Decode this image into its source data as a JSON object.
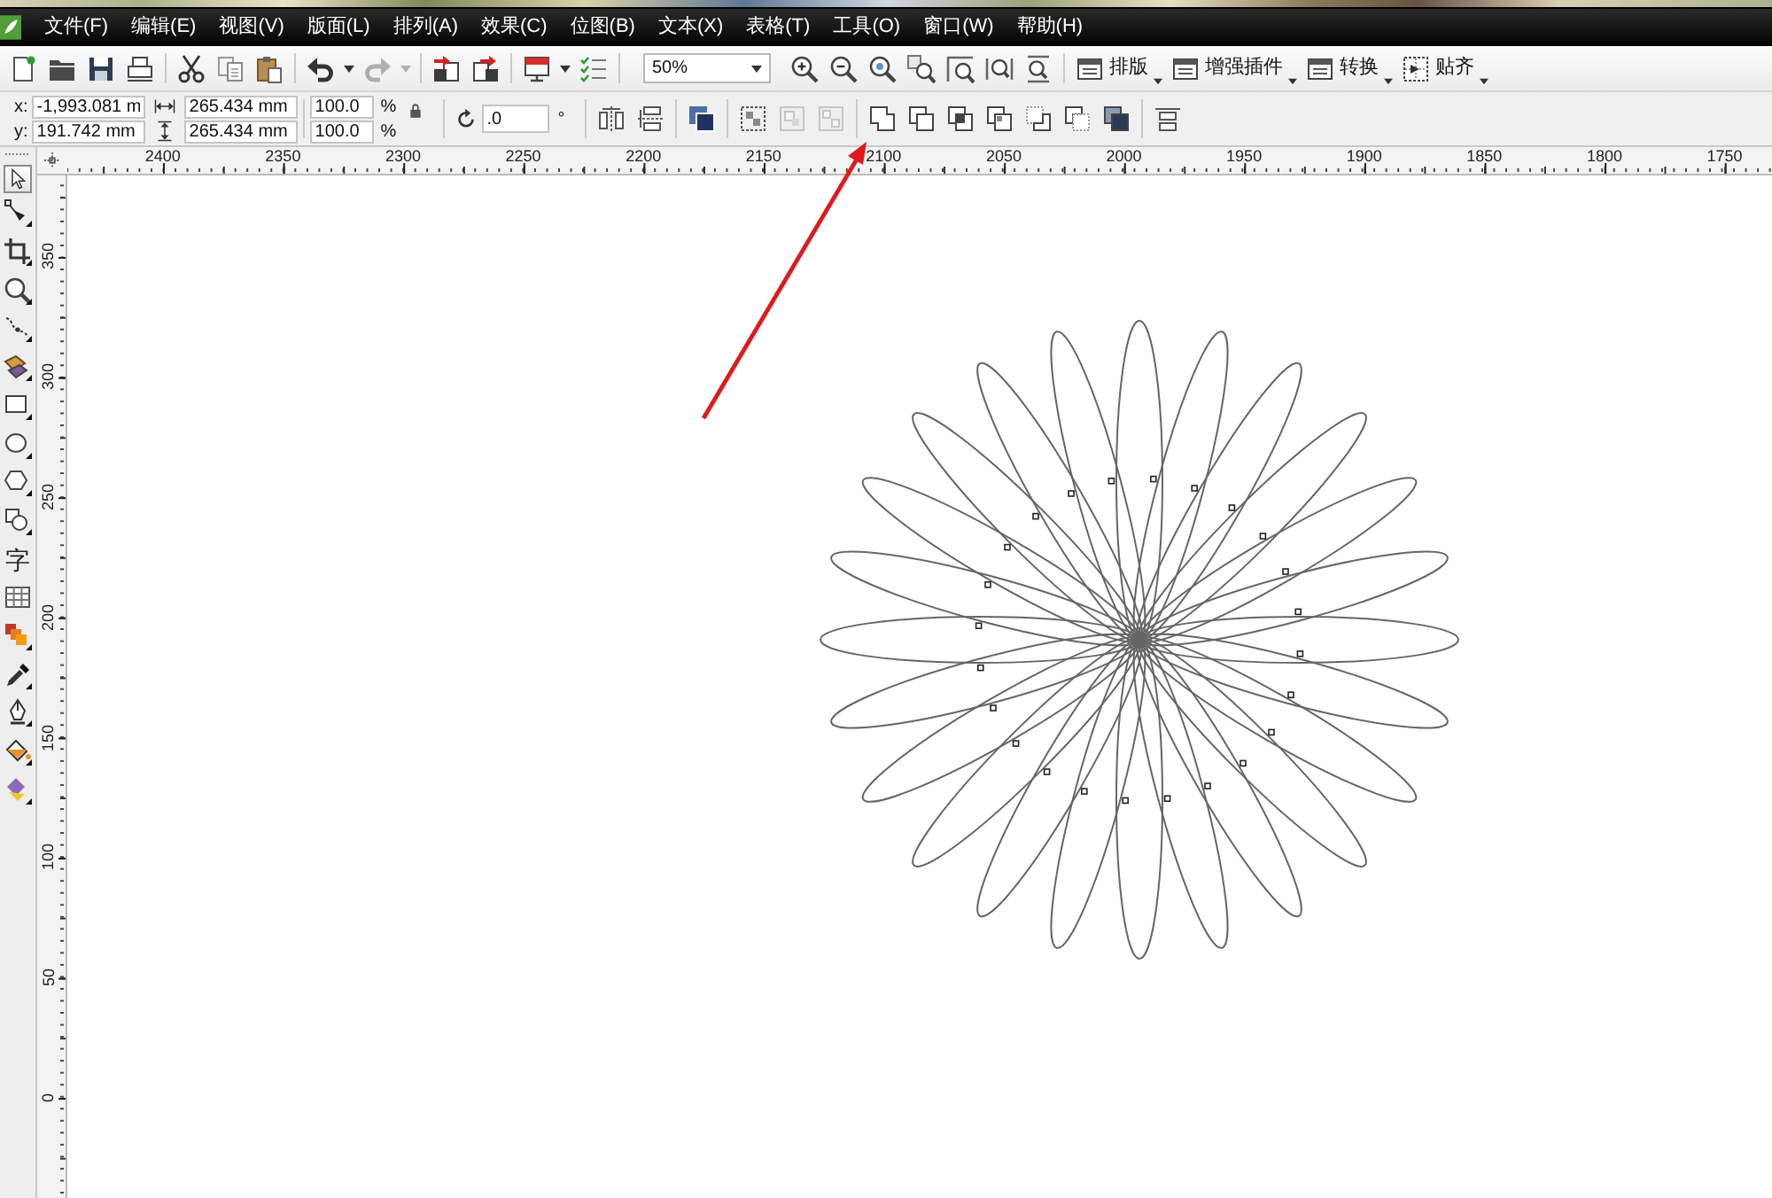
{
  "menu_bar": {
    "items": [
      "文件(F)",
      "编辑(E)",
      "视图(V)",
      "版面(L)",
      "排列(A)",
      "效果(C)",
      "位图(B)",
      "文本(X)",
      "表格(T)",
      "工具(O)",
      "窗口(W)",
      "帮助(H)"
    ]
  },
  "standard_toolbar": {
    "groups": [
      {
        "items": [
          {
            "kind": "new",
            "disabled": false
          },
          {
            "kind": "open",
            "disabled": false
          },
          {
            "kind": "save",
            "disabled": false
          },
          {
            "kind": "print",
            "disabled": false
          }
        ]
      },
      {
        "items": [
          {
            "kind": "cut",
            "disabled": false
          },
          {
            "kind": "copy",
            "disabled": false
          },
          {
            "kind": "paste",
            "disabled": false
          }
        ]
      },
      {
        "items": [
          {
            "kind": "undo",
            "disabled": false
          },
          {
            "kind": "caret",
            "disabled": false
          },
          {
            "kind": "redo",
            "disabled": true
          },
          {
            "kind": "caret",
            "disabled": true
          }
        ]
      },
      {
        "items": [
          {
            "kind": "import",
            "disabled": false
          },
          {
            "kind": "export",
            "disabled": false
          }
        ]
      },
      {
        "items": [
          {
            "kind": "launcher",
            "disabled": false
          },
          {
            "kind": "caret",
            "disabled": false
          },
          {
            "kind": "options",
            "disabled": false
          }
        ]
      }
    ],
    "zoom_level": {
      "value": "50%"
    },
    "zoom_tools": [
      {
        "kind": "zoom-in",
        "disabled": false
      },
      {
        "kind": "zoom-out",
        "disabled": false
      },
      {
        "kind": "zoom-selection",
        "disabled": false
      },
      {
        "kind": "zoom-objects",
        "disabled": false
      },
      {
        "kind": "zoom-page",
        "disabled": false
      },
      {
        "kind": "zoom-width",
        "disabled": false
      },
      {
        "kind": "zoom-height",
        "disabled": false
      }
    ],
    "menu_buttons": [
      {
        "kind": "panel",
        "label": "排版"
      },
      {
        "kind": "panel",
        "label": "增强插件"
      },
      {
        "kind": "panel",
        "label": "转换"
      },
      {
        "kind": "snap",
        "label": "贴齐"
      }
    ]
  },
  "property_bar": {
    "position": [
      {
        "label": "x:",
        "value": "-1,993.081 m"
      },
      {
        "label": "y:",
        "value": "191.742 mm"
      }
    ],
    "size": [
      {
        "kind": "width",
        "value": "265.434 mm"
      },
      {
        "kind": "height",
        "value": "265.434 mm"
      }
    ],
    "scale": [
      {
        "value": "100.0",
        "unit": "%"
      },
      {
        "value": "100.0",
        "unit": "%"
      }
    ],
    "rotation": {
      "value": ".0",
      "unit": "°"
    },
    "tool_groups": [
      {
        "items": [
          {
            "kind": "mirror-h",
            "disabled": false
          },
          {
            "kind": "mirror-v",
            "disabled": false
          }
        ]
      },
      {
        "items": [
          {
            "kind": "order",
            "disabled": false
          }
        ]
      },
      {
        "items": [
          {
            "kind": "group",
            "disabled": false
          },
          {
            "kind": "ungroup",
            "disabled": true
          },
          {
            "kind": "ungroup-all",
            "disabled": true
          }
        ]
      },
      {
        "items": [
          {
            "kind": "weld",
            "disabled": false
          },
          {
            "kind": "trim",
            "disabled": false
          },
          {
            "kind": "intersect",
            "disabled": false
          },
          {
            "kind": "simplify",
            "disabled": false
          },
          {
            "kind": "front-minus-back",
            "disabled": false
          },
          {
            "kind": "back-minus-front",
            "disabled": false
          },
          {
            "kind": "boundary",
            "disabled": false
          }
        ]
      },
      {
        "items": [
          {
            "kind": "align",
            "disabled": false
          }
        ]
      }
    ]
  },
  "toolbox": {
    "tools": [
      {
        "kind": "pick",
        "selected": true
      },
      {
        "kind": "shape",
        "selected": false
      },
      {
        "kind": "crop",
        "selected": false
      },
      {
        "kind": "zoom",
        "selected": false
      },
      {
        "kind": "curve",
        "selected": false
      },
      {
        "kind": "smart-fill",
        "selected": false
      },
      {
        "kind": "rectangle",
        "selected": false
      },
      {
        "kind": "ellipse",
        "selected": false
      },
      {
        "kind": "polygon",
        "selected": false
      },
      {
        "kind": "basic-shapes",
        "selected": false
      },
      {
        "kind": "text",
        "label": "字",
        "selected": false
      },
      {
        "kind": "table",
        "selected": false
      },
      {
        "kind": "blend",
        "selected": false
      },
      {
        "kind": "eyedropper",
        "selected": false
      },
      {
        "kind": "outline",
        "selected": false
      },
      {
        "kind": "fill",
        "selected": false
      },
      {
        "kind": "interactive-fill",
        "selected": false
      }
    ]
  },
  "rulers": {
    "horizontal": [
      "2400",
      "2350",
      "2300",
      "2250",
      "2200",
      "2150",
      "2100",
      "2050",
      "2000",
      "1950",
      "1900",
      "1850",
      "1800",
      "1750"
    ],
    "vertical": [
      "350",
      "300",
      "250",
      "200",
      "150",
      "100",
      "50",
      "0"
    ]
  }
}
